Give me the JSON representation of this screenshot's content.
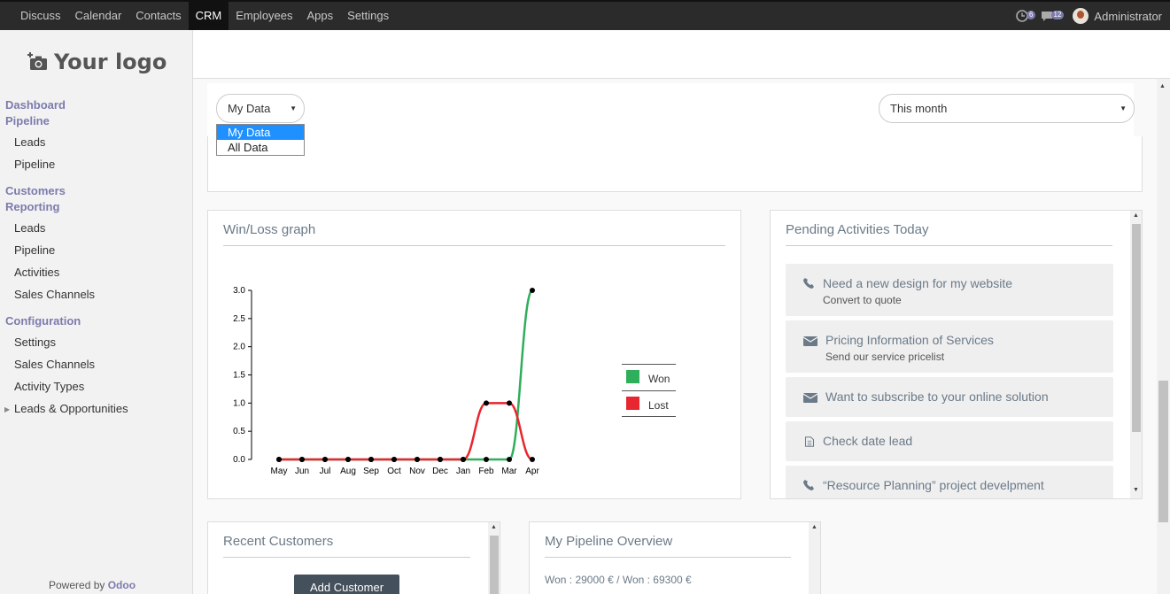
{
  "topbar": {
    "menu": [
      "Discuss",
      "Calendar",
      "Contacts",
      "CRM",
      "Employees",
      "Apps",
      "Settings"
    ],
    "active": "CRM",
    "activity_badge": "6",
    "message_badge": "12",
    "user": "Administrator"
  },
  "sidebar": {
    "logo_text": "Your logo",
    "dashboard": "Dashboard",
    "pipeline_head": "Pipeline",
    "pipeline_items": [
      "Leads",
      "Pipeline"
    ],
    "customers": "Customers",
    "reporting": "Reporting",
    "reporting_items": [
      "Leads",
      "Pipeline",
      "Activities",
      "Sales Channels"
    ],
    "configuration": "Configuration",
    "configuration_items": [
      "Settings",
      "Sales Channels",
      "Activity Types",
      "Leads & Opportunities"
    ],
    "powered_by": "Powered by",
    "powered_brand": "Odoo"
  },
  "filters": {
    "data_select": "My Data",
    "data_options": [
      "My Data",
      "All Data"
    ],
    "period_select": "This month"
  },
  "winloss": {
    "title": "Win/Loss graph",
    "legend": [
      {
        "name": "Won",
        "color": "#2fae5b"
      },
      {
        "name": "Lost",
        "color": "#e8262f"
      }
    ]
  },
  "chart_data": {
    "type": "line",
    "title": "Win/Loss graph",
    "categories": [
      "May",
      "Jun",
      "Jul",
      "Aug",
      "Sep",
      "Oct",
      "Nov",
      "Dec",
      "Jan",
      "Feb",
      "Mar",
      "Apr"
    ],
    "y_ticks": [
      "0.0",
      "0.5",
      "1.0",
      "1.5",
      "2.0",
      "2.5",
      "3.0"
    ],
    "ylim": [
      0,
      3
    ],
    "series": [
      {
        "name": "Won",
        "color": "#2fae5b",
        "values": [
          0,
          0,
          0,
          0,
          0,
          0,
          0,
          0,
          0,
          0,
          0,
          3
        ]
      },
      {
        "name": "Lost",
        "color": "#e8262f",
        "values": [
          0,
          0,
          0,
          0,
          0,
          0,
          0,
          0,
          0,
          1,
          1,
          0
        ]
      }
    ],
    "legend": "right",
    "grid": false
  },
  "activities": {
    "title": "Pending Activities Today",
    "items": [
      {
        "icon": "phone-icon",
        "title": "Need a new design for my website",
        "subtitle": "Convert to quote"
      },
      {
        "icon": "envelope-icon",
        "title": "Pricing Information of Services",
        "subtitle": "Send our service pricelist"
      },
      {
        "icon": "envelope-icon",
        "title": "Want to subscribe to your online solution",
        "subtitle": ""
      },
      {
        "icon": "document-icon",
        "title": "Check date lead",
        "subtitle": ""
      },
      {
        "icon": "phone-icon",
        "title": "“Resource Planning” project develpment",
        "subtitle": ""
      }
    ]
  },
  "recent_customers": {
    "title": "Recent Customers",
    "add_button": "Add Customer"
  },
  "pipeline_overview": {
    "title": "My Pipeline Overview",
    "summary": "Won : 29000 € / Won : 69300 €"
  }
}
